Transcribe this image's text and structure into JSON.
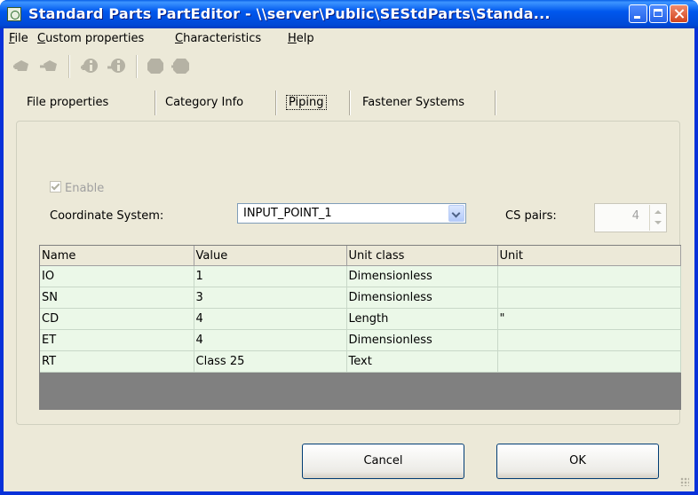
{
  "window": {
    "title": "Standard Parts PartEditor - \\\\server\\Public\\SEStdParts\\Standa...",
    "title_color": "#0058ee",
    "icon": "app-icon"
  },
  "menubar": {
    "items": [
      {
        "label": "File",
        "mnemonic": "F",
        "rest": "ile"
      },
      {
        "label": "Custom properties",
        "mnemonic": "C",
        "rest": "ustom properties"
      },
      {
        "label": "Characteristics",
        "mnemonic": "C",
        "rest": "haracteristics"
      },
      {
        "label": "Help",
        "mnemonic": "H",
        "rest": "elp"
      }
    ]
  },
  "toolbar": {
    "icons": [
      "add-part-icon",
      "remove-part-icon",
      "add-info-icon",
      "remove-info-icon",
      "add-object-icon",
      "remove-object-icon"
    ]
  },
  "tabs": [
    {
      "label": "File properties",
      "active": false
    },
    {
      "label": "Category Info",
      "active": false
    },
    {
      "label": "Piping",
      "active": true
    },
    {
      "label": "Fastener Systems",
      "active": false
    }
  ],
  "piping": {
    "enable_label": "Enable",
    "enable_checked": true,
    "coordinate_system_label": "Coordinate System:",
    "coordinate_system_value": "INPUT_POINT_1",
    "cs_pairs_label": "CS pairs:",
    "cs_pairs_value": "4"
  },
  "grid": {
    "columns": [
      "Name",
      "Value",
      "Unit class",
      "Unit"
    ],
    "rows": [
      {
        "name": "IO",
        "value": "1",
        "unit_class": "Dimensionless",
        "unit": ""
      },
      {
        "name": "SN",
        "value": "3",
        "unit_class": "Dimensionless",
        "unit": ""
      },
      {
        "name": "CD",
        "value": "4",
        "unit_class": "Length",
        "unit": "\""
      },
      {
        "name": "ET",
        "value": "4",
        "unit_class": "Dimensionless",
        "unit": ""
      },
      {
        "name": "RT",
        "value": "Class 25",
        "unit_class": "Text",
        "unit": ""
      }
    ],
    "row_color": "#ebf8e8"
  },
  "buttons": {
    "cancel_label": "Cancel",
    "ok_label": "OK"
  }
}
